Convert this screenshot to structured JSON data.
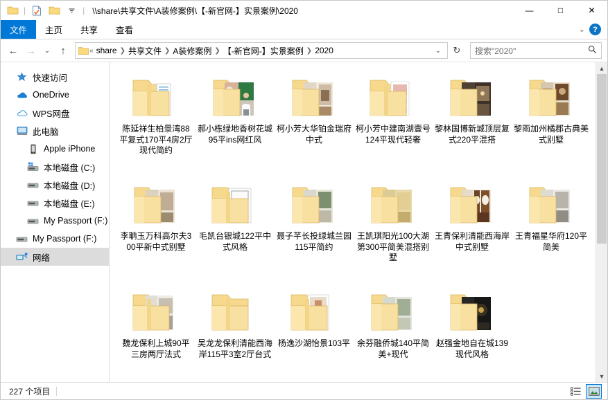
{
  "window": {
    "title": "\\\\share\\共享文件\\A装修案例\\【-新官网-】实景案例\\2020",
    "minimize_label": "—",
    "maximize_label": "□",
    "close_label": "✕"
  },
  "quick_access": {
    "items": [
      {
        "name": "folder-icon",
        "label": ""
      },
      {
        "name": "properties-icon",
        "label": ""
      },
      {
        "name": "new-folder-icon",
        "label": ""
      }
    ],
    "dropdown_label": "▾"
  },
  "ribbon": {
    "tabs": [
      {
        "label": "文件",
        "active": true
      },
      {
        "label": "主页",
        "active": false
      },
      {
        "label": "共享",
        "active": false
      },
      {
        "label": "查看",
        "active": false
      }
    ],
    "collapse_label": "⌄",
    "help_label": "?"
  },
  "address": {
    "back_label": "←",
    "forward_label": "→",
    "recent_label": "⌄",
    "up_label": "↑",
    "overflow_label": "«",
    "crumbs": [
      "share",
      "共享文件",
      "A装修案例",
      "【-新官网-】实景案例",
      "2020"
    ],
    "separator": "❯",
    "dropdown_label": "⌄",
    "refresh_label": "↻"
  },
  "search": {
    "placeholder": "搜索\"2020\"",
    "icon_label": "⌕"
  },
  "sidebar": {
    "items": [
      {
        "label": "快速访问",
        "icon": "star-icon",
        "indent": false,
        "selected": false
      },
      {
        "label": "OneDrive",
        "icon": "cloud-icon",
        "indent": false,
        "selected": false
      },
      {
        "label": "WPS网盘",
        "icon": "wps-cloud-icon",
        "indent": false,
        "selected": false
      },
      {
        "label": "此电脑",
        "icon": "computer-icon",
        "indent": false,
        "selected": false
      },
      {
        "label": "Apple iPhone",
        "icon": "phone-icon",
        "indent": true,
        "selected": false
      },
      {
        "label": "本地磁盘 (C:)",
        "icon": "system-drive-icon",
        "indent": true,
        "selected": false
      },
      {
        "label": "本地磁盘 (D:)",
        "icon": "drive-icon",
        "indent": true,
        "selected": false
      },
      {
        "label": "本地磁盘 (E:)",
        "icon": "drive-icon",
        "indent": true,
        "selected": false
      },
      {
        "label": "My Passport (F:)",
        "icon": "drive-icon",
        "indent": true,
        "selected": false
      },
      {
        "label": "My Passport (F:)",
        "icon": "drive-icon",
        "indent": false,
        "selected": false
      },
      {
        "label": "网络",
        "icon": "network-icon",
        "indent": false,
        "selected": true
      }
    ]
  },
  "files": [
    {
      "name": "陈延祥生柏景湾88平复式170平4房2厅现代简约",
      "thumb": "doc"
    },
    {
      "name": "郝小栋绿地香树花城95平ins网红风",
      "thumb": "photo-person"
    },
    {
      "name": "柯小芳大华铂金瑞府中式",
      "thumb": "interior-warm"
    },
    {
      "name": "柯小芳中建南湖壹号124平现代轻奢",
      "thumb": "photo-light"
    },
    {
      "name": "黎林国博新城顶层复式220平混搭",
      "thumb": "interior-dark"
    },
    {
      "name": "黎雨加州橘郡古典美式别墅",
      "thumb": "interior-classic"
    },
    {
      "name": "李聃玉万科高尔夫300平新中式别墅",
      "thumb": "interior-beige"
    },
    {
      "name": "毛凯台银城122平中式风格",
      "thumb": "plan-white"
    },
    {
      "name": "聂子芊长投绿城兰园115平简约",
      "thumb": "interior-green"
    },
    {
      "name": "王凯琪阳光100大湖第300平简美混搭别墅",
      "thumb": "interior-yellow"
    },
    {
      "name": "王青保利清能西海岸中式别墅",
      "thumb": "interior-wood"
    },
    {
      "name": "王青福星华府120平简美",
      "thumb": "interior-grey"
    },
    {
      "name": "魏龙保利上城90平三房两厅法式",
      "thumb": "interior-pale"
    },
    {
      "name": "吴龙龙保利清能西海岸115平3室2厅台式",
      "thumb": "plain"
    },
    {
      "name": "杨逸沙湖怡景103平",
      "thumb": "photo-poster"
    },
    {
      "name": "余芬融侨城140平简美+现代",
      "thumb": "interior-softgreen"
    },
    {
      "name": "赵强金地自在城139现代风格",
      "thumb": "interior-black"
    }
  ],
  "statusbar": {
    "item_count": "227 个项目",
    "views": [
      {
        "name": "details-view",
        "active": false
      },
      {
        "name": "large-icons-view",
        "active": true
      }
    ]
  },
  "colors": {
    "accent": "#0078d7",
    "folder": "#fbdf8b",
    "selection": "#dcdcdc",
    "help_blue": "#0b74c4"
  }
}
